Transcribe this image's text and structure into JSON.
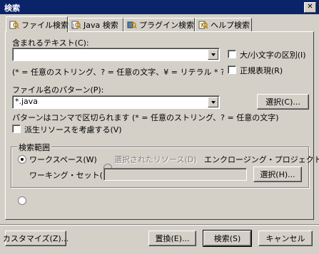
{
  "window": {
    "title": "検索",
    "close_glyph": "✕"
  },
  "tabs": [
    {
      "label": "ファイル検索",
      "active": true,
      "icon": "file-search-icon"
    },
    {
      "label": "Java 検索",
      "active": false,
      "icon": "java-search-icon"
    },
    {
      "label": "プラグイン検索",
      "active": false,
      "icon": "plugin-search-icon"
    },
    {
      "label": "ヘルプ検索",
      "active": false,
      "icon": "help-search-icon"
    }
  ],
  "containing_text": {
    "label": "含まれるテキスト(C):",
    "value": "",
    "hint": "(* = 任意のストリング、? = 任意の文字、¥ = リテラル * ? ¥ のエスケープ)"
  },
  "options": {
    "case_sensitive": "大/小文字の区別(I)",
    "regex": "正規表現(R)"
  },
  "file_pattern": {
    "label": "ファイル名のパターン(P):",
    "value": "*.java",
    "choose_button": "選択(C)...",
    "hint": "パターンはコンマで区切られます (* = 任意のストリング、? = 任意の文字)"
  },
  "derived": {
    "label": "派生リソースを考慮する(V)"
  },
  "scope": {
    "legend": "検索範囲",
    "workspace": "ワークスペース(W)",
    "selected_resources": "選択されたリソース(D)",
    "enclosing_projects": "エンクロージング・プロジェクト(J)",
    "working_set": "ワーキング・セット(K):",
    "working_set_value": "",
    "working_set_choose": "選択(H)..."
  },
  "footer": {
    "customize": "カスタマイズ(Z)...",
    "replace": "置換(E)...",
    "search": "検索(S)",
    "cancel": "キャンセル"
  }
}
